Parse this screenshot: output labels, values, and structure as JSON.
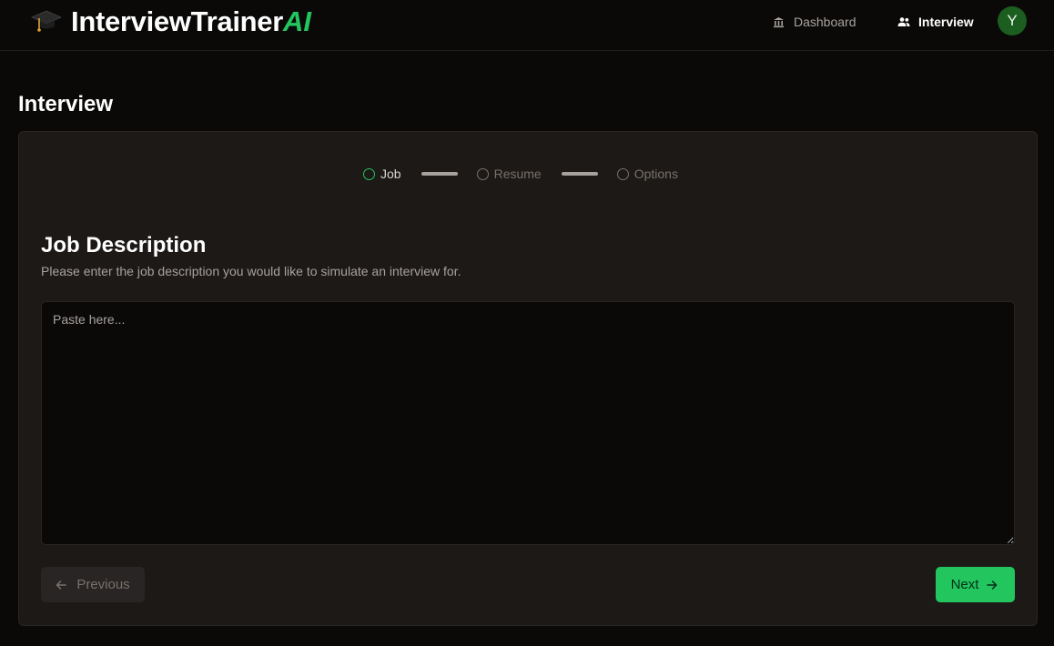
{
  "app": {
    "logo_icon": "graduation-cap-icon",
    "name": "InterviewTrainer",
    "name_accent": "AI",
    "accent_color": "#22c55e"
  },
  "nav": {
    "dashboard": {
      "label": "Dashboard",
      "icon": "bank-icon"
    },
    "interview": {
      "label": "Interview",
      "icon": "people-icon"
    }
  },
  "user": {
    "avatar_initial": "Y",
    "avatar_color": "#1b5e20"
  },
  "page": {
    "title": "Interview"
  },
  "stepper": {
    "steps": [
      {
        "label": "Job",
        "active": true
      },
      {
        "label": "Resume",
        "active": false
      },
      {
        "label": "Options",
        "active": false
      }
    ]
  },
  "form": {
    "title": "Job Description",
    "description": "Please enter the job description you would like to simulate an interview for.",
    "placeholder": "Paste here...",
    "value": ""
  },
  "actions": {
    "previous_label": "Previous",
    "previous_icon": "arrow-left-icon",
    "next_label": "Next",
    "next_icon": "arrow-right-icon"
  }
}
